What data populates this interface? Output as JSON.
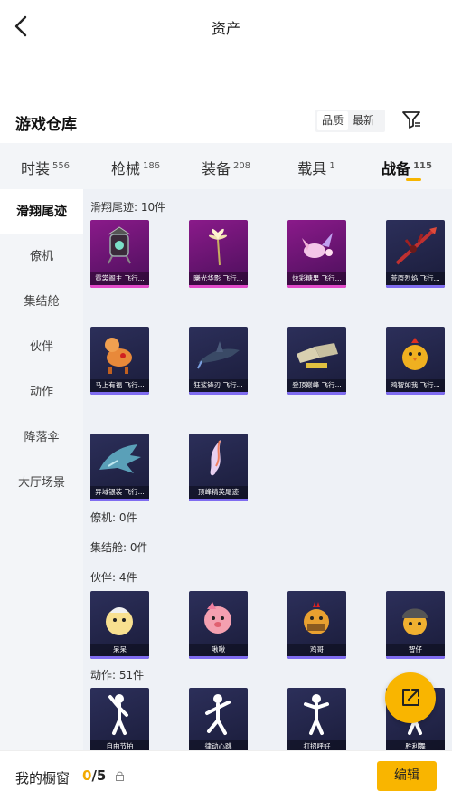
{
  "header": {
    "title": "资产"
  },
  "warehouse": {
    "title": "游戏仓库",
    "sort_options": [
      "品质",
      "最新"
    ],
    "active_sort": "品质"
  },
  "tabs": [
    {
      "label": "时装",
      "count": "556"
    },
    {
      "label": "枪械",
      "count": "186"
    },
    {
      "label": "装备",
      "count": "208"
    },
    {
      "label": "载具",
      "count": "1"
    },
    {
      "label": "战备",
      "count": "115",
      "active": true
    }
  ],
  "sidebar": {
    "items": [
      "滑翔尾迹",
      "僚机",
      "集结舱",
      "伙伴",
      "动作",
      "降落伞",
      "大厅场景"
    ],
    "active": "滑翔尾迹"
  },
  "sections": {
    "trail": {
      "title": "滑翔尾迹: 10件",
      "items": [
        {
          "name": "霓裳阁主 飞行...",
          "icon": "lantern-icon",
          "style": "purple"
        },
        {
          "name": "曦光华影 飞行...",
          "icon": "flower-icon",
          "style": "purple"
        },
        {
          "name": "炫彩糖果 飞行...",
          "icon": "candy-icon",
          "style": "purple"
        },
        {
          "name": "荒原烈焰 飞行...",
          "icon": "spear-icon",
          "style": "dark"
        },
        {
          "name": "马上有福 飞行...",
          "icon": "horse-icon",
          "style": "dark"
        },
        {
          "name": "狂鲨锋刃 飞行...",
          "icon": "shark-icon",
          "style": "dark"
        },
        {
          "name": "登顶巅峰 飞行...",
          "icon": "boots-icon",
          "style": "dark"
        },
        {
          "name": "鸡智如我 飞行...",
          "icon": "chick-icon",
          "style": "dark"
        },
        {
          "name": "异域银装 飞行...",
          "icon": "dragon-icon",
          "style": "dark"
        },
        {
          "name": "顶峰精英尾迹",
          "icon": "flame-trail-icon",
          "style": "dark"
        }
      ]
    },
    "wingman": {
      "title": "僚机: 0件"
    },
    "capsule": {
      "title": "集结舱: 0件"
    },
    "partner": {
      "title": "伙伴: 4件",
      "items": [
        {
          "name": "呆呆",
          "icon": "yellow-chick-icon"
        },
        {
          "name": "啾啾",
          "icon": "pink-bird-icon"
        },
        {
          "name": "鸡哥",
          "icon": "rooster-icon"
        },
        {
          "name": "智仔",
          "icon": "helmet-chick-icon"
        }
      ]
    },
    "emote": {
      "title": "动作: 51件",
      "items": [
        {
          "name": "自由节拍",
          "icon": "dance-icon"
        },
        {
          "name": "律动心跳",
          "icon": "dance-icon"
        },
        {
          "name": "打招呼好",
          "icon": "dance-icon"
        },
        {
          "name": "胜利舞",
          "icon": "dance-icon"
        }
      ]
    }
  },
  "bottom": {
    "showcase_label": "我的橱窗",
    "current": "0",
    "total": "/5",
    "edit_label": "编辑"
  },
  "colors": {
    "accent": "#f9b500",
    "purple_card": "#8a1a8a",
    "dark_card": "#2c2f5a",
    "rarity_purple": "#e24ac9",
    "rarity_blue": "#7f6cf0"
  }
}
